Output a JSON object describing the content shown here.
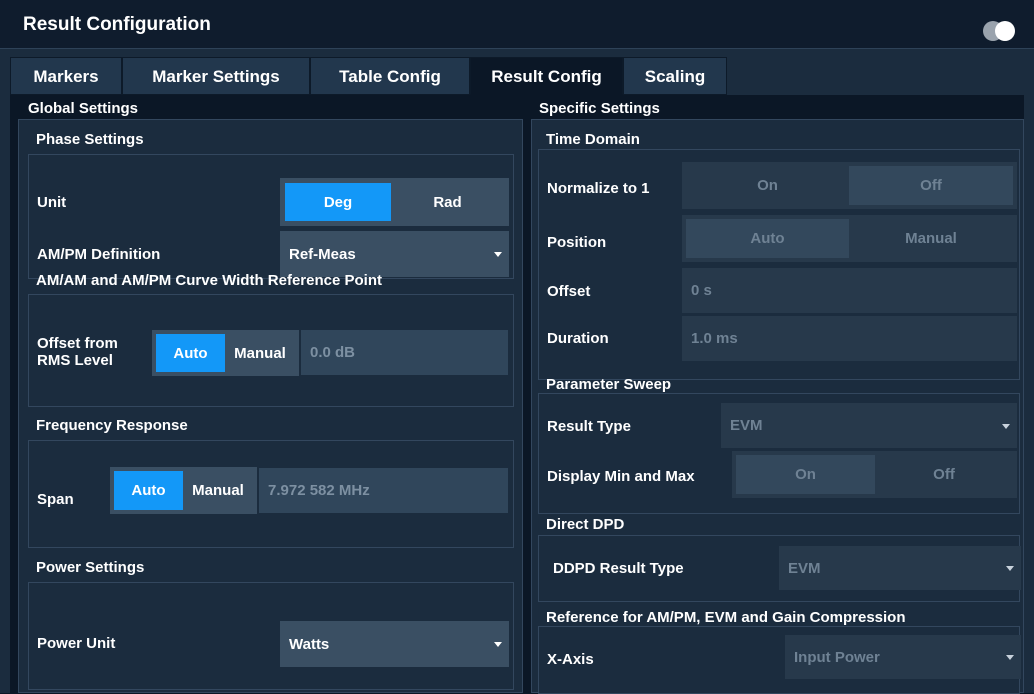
{
  "window": {
    "title": "Result Configuration",
    "toggle_icon": "toggle-switch-icon"
  },
  "tabs": [
    {
      "label": "Markers"
    },
    {
      "label": "Marker Settings"
    },
    {
      "label": "Table Config"
    },
    {
      "label": "Result Config"
    },
    {
      "label": "Scaling"
    }
  ],
  "active_tab": "Result Config",
  "global": {
    "title": "Global Settings",
    "phase": {
      "title": "Phase Settings",
      "unit_label": "Unit",
      "unit_options": [
        "Deg",
        "Rad"
      ],
      "unit_selected": "Deg",
      "ampm_label": "AM/PM Definition",
      "ampm_value": "Ref-Meas"
    },
    "curve": {
      "title": "AM/AM and AM/PM Curve Width Reference Point",
      "offset_label_line1": "Offset from",
      "offset_label_line2": "RMS Level",
      "options": [
        "Auto",
        "Manual"
      ],
      "selected": "Auto",
      "value": "0.0 dB"
    },
    "freq": {
      "title": "Frequency Response",
      "span_label": "Span",
      "options": [
        "Auto",
        "Manual"
      ],
      "selected": "Auto",
      "value": "7.972 582 MHz"
    },
    "power": {
      "title": "Power Settings",
      "unit_label": "Power Unit",
      "unit_value": "Watts"
    }
  },
  "specific": {
    "title": "Specific Settings",
    "time": {
      "title": "Time Domain",
      "normalize_label": "Normalize to 1",
      "normalize_options": [
        "On",
        "Off"
      ],
      "normalize_selected": "Off",
      "position_label": "Position",
      "position_options": [
        "Auto",
        "Manual"
      ],
      "position_selected": "Auto",
      "offset_label": "Offset",
      "offset_value": "0 s",
      "duration_label": "Duration",
      "duration_value": "1.0 ms"
    },
    "sweep": {
      "title": "Parameter Sweep",
      "result_type_label": "Result Type",
      "result_type_value": "EVM",
      "minmax_label": "Display Min and Max",
      "minmax_options": [
        "On",
        "Off"
      ],
      "minmax_selected": "On"
    },
    "ddpd": {
      "title": "Direct DPD",
      "result_type_label": "DDPD Result Type",
      "result_type_value": "EVM"
    },
    "reference": {
      "title": "Reference for AM/PM, EVM and Gain Compression",
      "xaxis_label": "X-Axis",
      "xaxis_value": "Input Power"
    }
  }
}
